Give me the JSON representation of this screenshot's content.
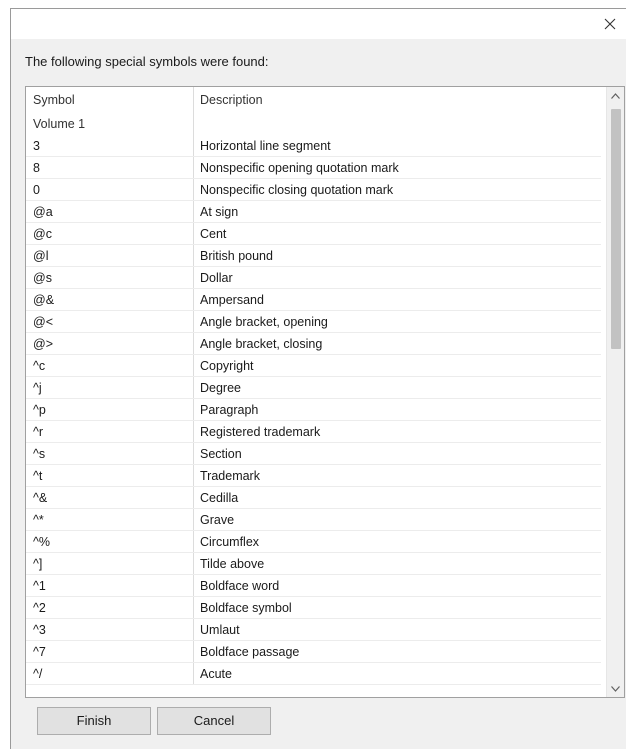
{
  "dialog": {
    "close_glyph": "✕",
    "prompt": "The following special symbols were found:"
  },
  "table": {
    "headers": {
      "symbol": "Symbol",
      "description": "Description"
    },
    "group_label": "Volume 1",
    "rows": [
      {
        "symbol": "3",
        "description": "Horizontal line segment"
      },
      {
        "symbol": "8",
        "description": "Nonspecific opening quotation mark"
      },
      {
        "symbol": "0",
        "description": "Nonspecific closing quotation mark"
      },
      {
        "symbol": "@a",
        "description": "At sign"
      },
      {
        "symbol": "@c",
        "description": "Cent"
      },
      {
        "symbol": "@l",
        "description": "British pound"
      },
      {
        "symbol": "@s",
        "description": "Dollar"
      },
      {
        "symbol": "@&",
        "description": "Ampersand"
      },
      {
        "symbol": "@<",
        "description": "Angle bracket, opening"
      },
      {
        "symbol": "@>",
        "description": "Angle bracket, closing"
      },
      {
        "symbol": "^c",
        "description": "Copyright"
      },
      {
        "symbol": "^j",
        "description": "Degree"
      },
      {
        "symbol": "^p",
        "description": "Paragraph"
      },
      {
        "symbol": "^r",
        "description": "Registered trademark"
      },
      {
        "symbol": "^s",
        "description": "Section"
      },
      {
        "symbol": "^t",
        "description": "Trademark"
      },
      {
        "symbol": "^&",
        "description": "Cedilla"
      },
      {
        "symbol": "^*",
        "description": "Grave"
      },
      {
        "symbol": "^%",
        "description": "Circumflex"
      },
      {
        "symbol": "^]",
        "description": "Tilde above"
      },
      {
        "symbol": "^1",
        "description": "Boldface word"
      },
      {
        "symbol": "^2",
        "description": "Boldface symbol"
      },
      {
        "symbol": "^3",
        "description": "Umlaut"
      },
      {
        "symbol": "^7",
        "description": "Boldface passage"
      },
      {
        "symbol": "^/",
        "description": "Acute"
      }
    ]
  },
  "buttons": {
    "finish": "Finish",
    "cancel": "Cancel"
  },
  "icons": {
    "close": "close-icon",
    "scroll_up": "chevron-up-icon",
    "scroll_down": "chevron-down-icon"
  }
}
